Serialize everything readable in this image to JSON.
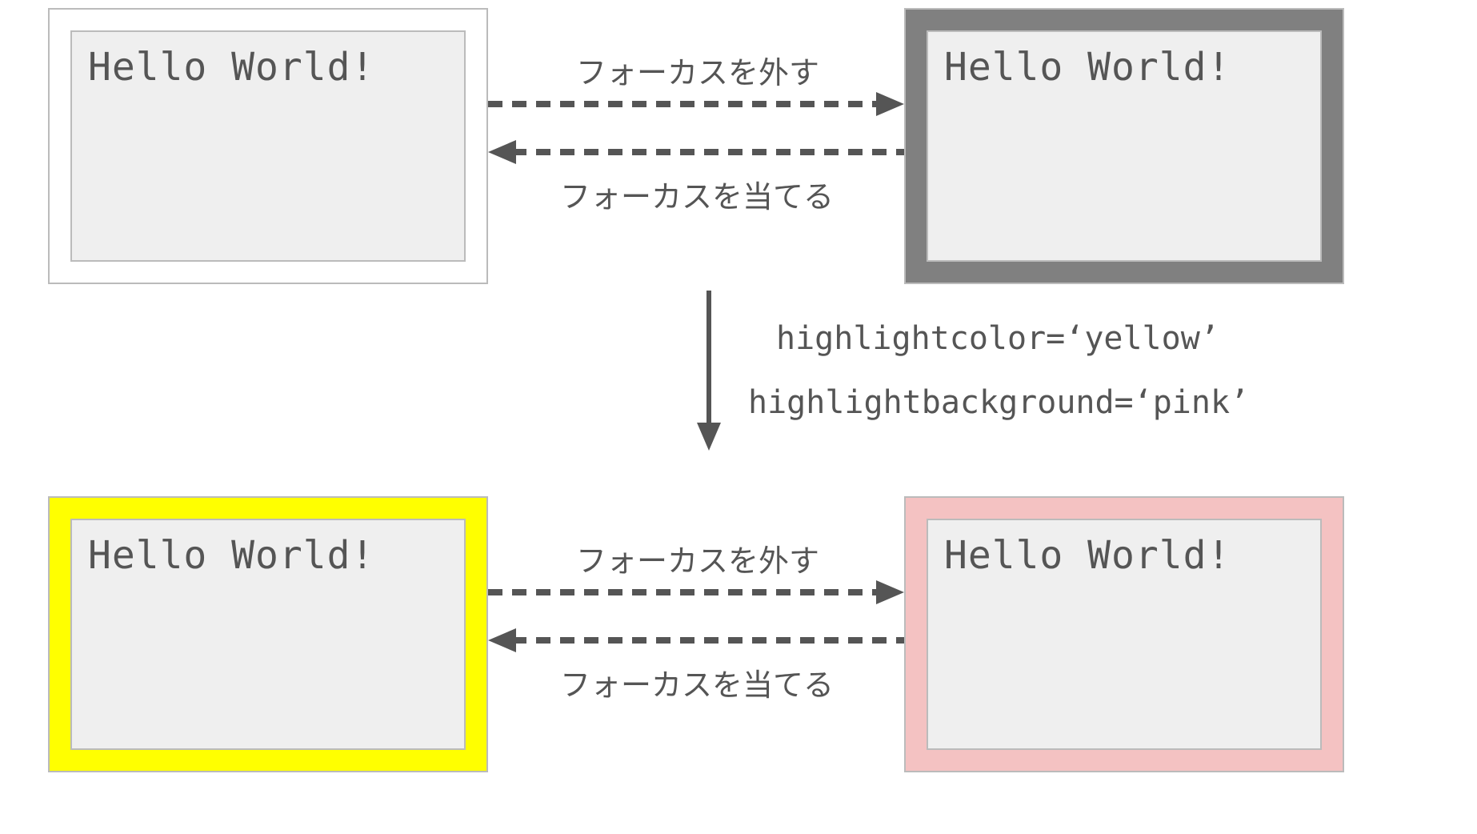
{
  "boxes": {
    "topLeft": {
      "text": "Hello World!"
    },
    "topRight": {
      "text": "Hello World!"
    },
    "bottomLeft": {
      "text": "Hello World!"
    },
    "bottomRight": {
      "text": "Hello World!"
    }
  },
  "arrows": {
    "topRowRight": "フォーカスを外す",
    "topRowLeft": "フォーカスを当てる",
    "bottomRowRight": "フォーカスを外す",
    "bottomRowLeft": "フォーカスを当てる"
  },
  "code": {
    "line1": "highlightcolor=‘yellow’",
    "line2": "highlightbackground=‘pink’"
  },
  "colors": {
    "white": "#ffffff",
    "gray": "#808080",
    "yellow": "#ffff00",
    "pink": "#f4c2c2",
    "arrow": "#555555"
  }
}
